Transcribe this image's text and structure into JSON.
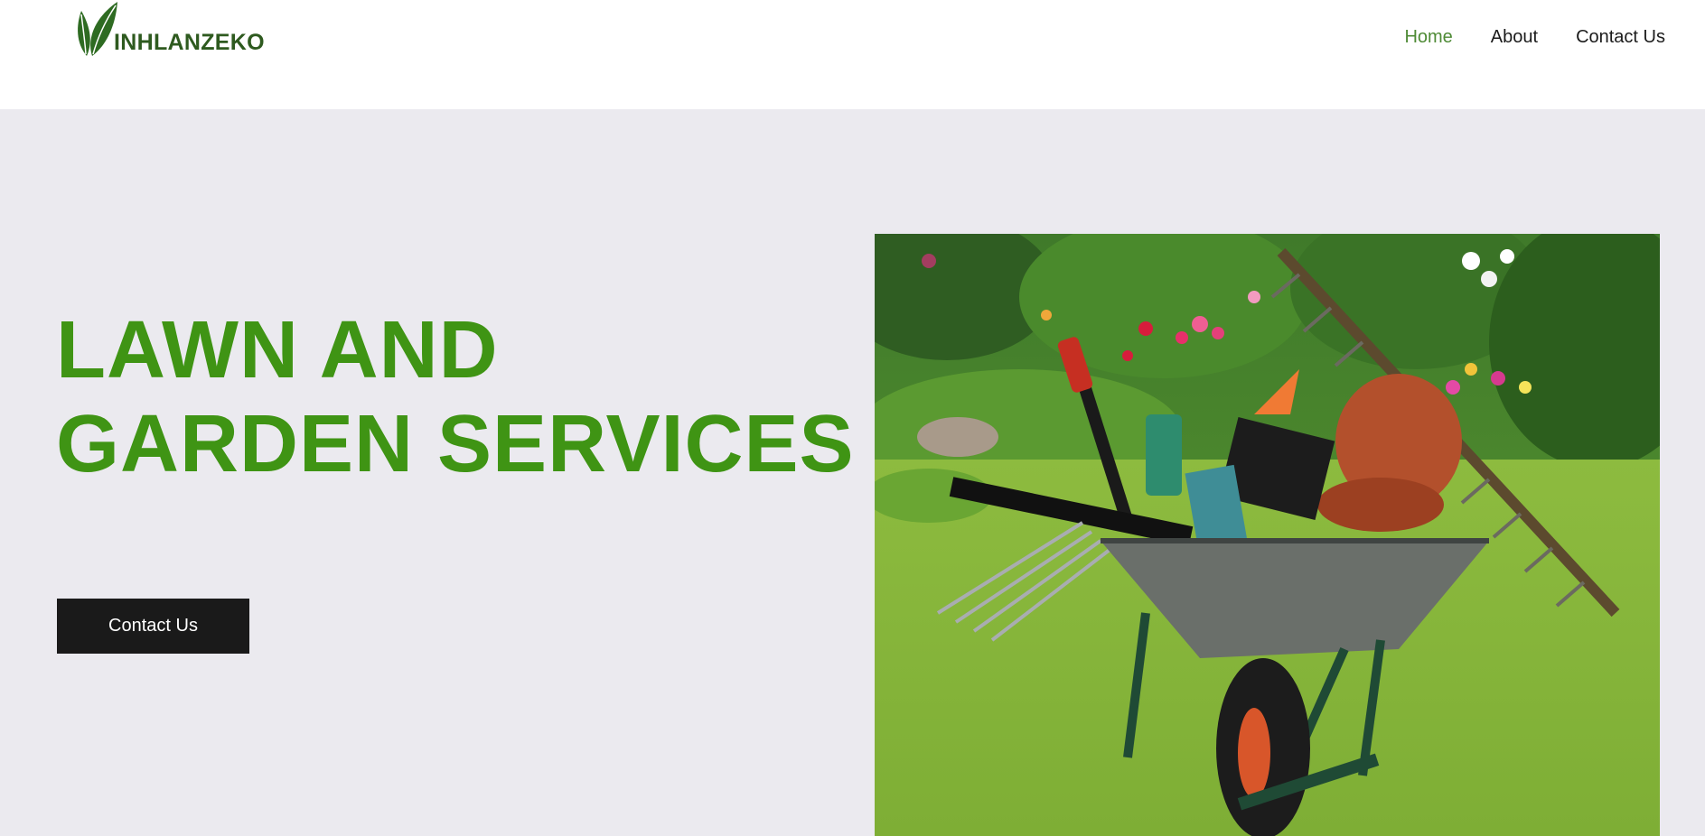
{
  "brand": {
    "name": "INHLANZEKO",
    "logo_icon": "leaf-icon",
    "color": "#2e5a1f"
  },
  "nav": {
    "items": [
      {
        "label": "Home",
        "active": true
      },
      {
        "label": "About",
        "active": false
      },
      {
        "label": "Contact Us",
        "active": false
      }
    ],
    "active_color": "#4e8a35"
  },
  "hero": {
    "title_line1": "LAWN AND",
    "title_line2": "GARDEN SERVICES",
    "title_color": "#3f9414",
    "cta_label": "Contact Us",
    "image_alt": "Wheelbarrow with garden tools and a rake on a lawn in front of flowering shrubs"
  }
}
